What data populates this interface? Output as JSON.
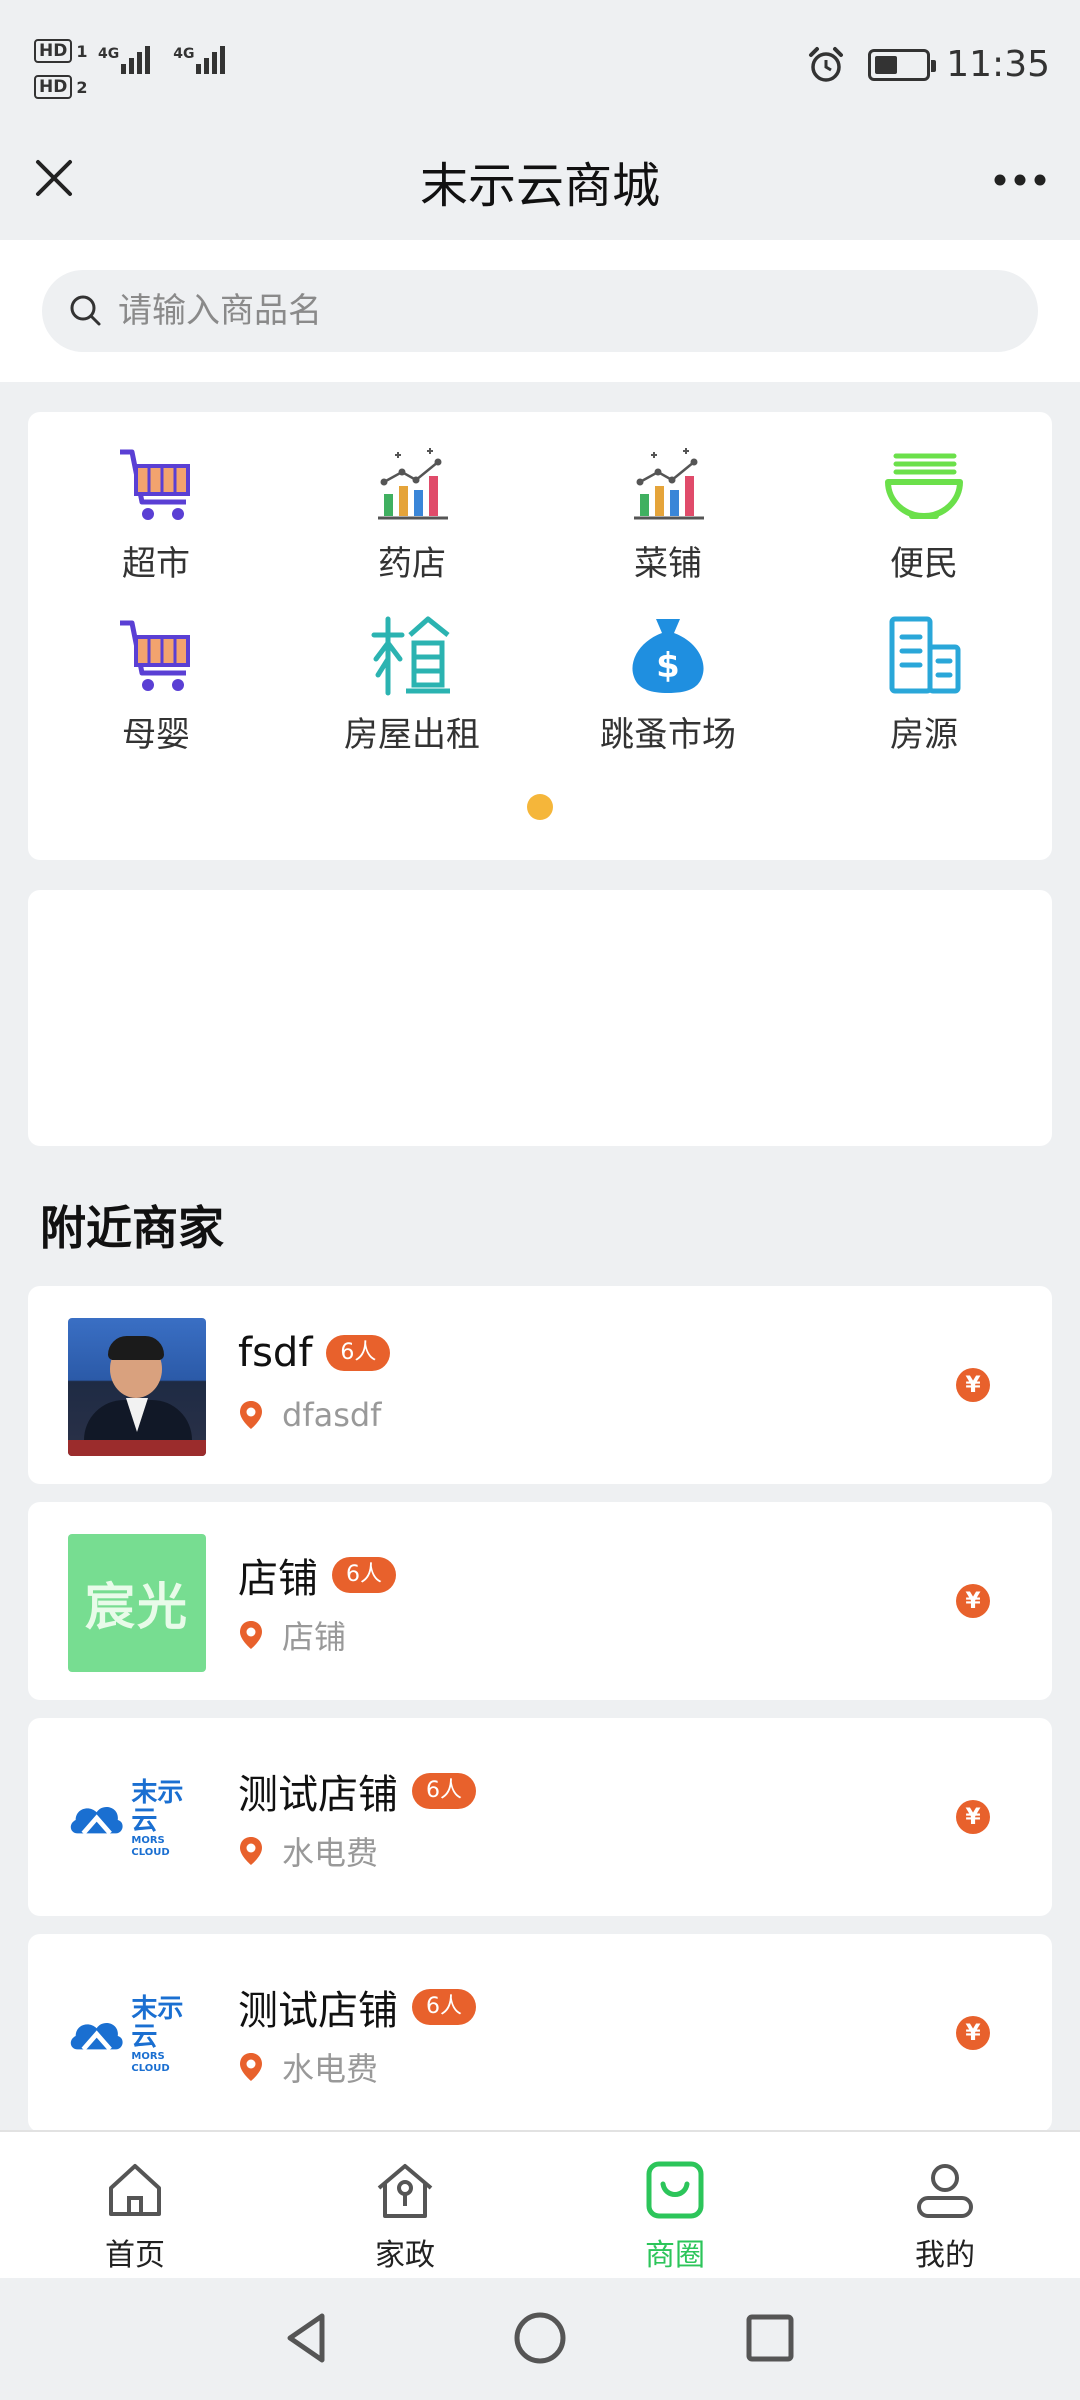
{
  "status_bar": {
    "sim1_badge": "HD",
    "sim1_num": "1",
    "sim2_badge": "HD",
    "sim2_num": "2",
    "net1": "4G",
    "net2": "4G",
    "battery_level": 0.45,
    "time": "11:35"
  },
  "title_bar": {
    "title": "末示云商城"
  },
  "search": {
    "placeholder": "请输入商品名"
  },
  "categories": [
    {
      "label": "超市",
      "icon": "shopping-cart-icon"
    },
    {
      "label": "药店",
      "icon": "bar-chart-icon"
    },
    {
      "label": "菜铺",
      "icon": "bar-chart-icon"
    },
    {
      "label": "便民",
      "icon": "noodle-bowl-icon"
    },
    {
      "label": "母婴",
      "icon": "shopping-cart-icon"
    },
    {
      "label": "房屋出租",
      "icon": "rent-house-icon"
    },
    {
      "label": "跳蚤市场",
      "icon": "money-bag-icon"
    },
    {
      "label": "房源",
      "icon": "building-icon"
    }
  ],
  "section_heading": "附近商家",
  "merchants": [
    {
      "name": "fsdf",
      "badge": "6人",
      "address": "dfasdf",
      "thumb": "photo"
    },
    {
      "name": "店铺",
      "badge": "6人",
      "address": "店铺",
      "thumb": "green",
      "thumb_text": "宸光"
    },
    {
      "name": "测试店铺",
      "badge": "6人",
      "address": "水电费",
      "thumb": "logo",
      "logo_cn": "末示云",
      "logo_en": "MORS CLOUD"
    },
    {
      "name": "测试店铺",
      "badge": "6人",
      "address": "水电费",
      "thumb": "logo",
      "logo_cn": "末示云",
      "logo_en": "MORS CLOUD"
    }
  ],
  "yen_symbol": "¥",
  "bottom_nav": [
    {
      "label": "首页",
      "icon": "home-icon",
      "active": false
    },
    {
      "label": "家政",
      "icon": "housekeeping-icon",
      "active": false
    },
    {
      "label": "商圈",
      "icon": "shopping-bag-icon",
      "active": true
    },
    {
      "label": "我的",
      "icon": "user-icon",
      "active": false
    }
  ],
  "colors": {
    "accent_green": "#2cc55a",
    "badge_orange": "#e8612c",
    "dot_yellow": "#f5b63a"
  }
}
